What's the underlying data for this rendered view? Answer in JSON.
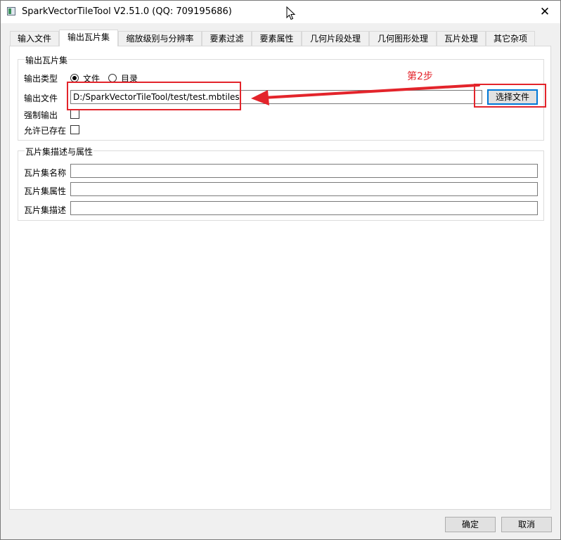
{
  "window": {
    "title": "SparkVectorTileTool V2.51.0  (QQ: 709195686)",
    "close_glyph": "✕"
  },
  "tabs": [
    {
      "label": "输入文件",
      "active": false
    },
    {
      "label": "输出瓦片集",
      "active": true
    },
    {
      "label": "缩放级别与分辨率",
      "active": false
    },
    {
      "label": "要素过滤",
      "active": false
    },
    {
      "label": "要素属性",
      "active": false
    },
    {
      "label": "几何片段处理",
      "active": false
    },
    {
      "label": "几何图形处理",
      "active": false
    },
    {
      "label": "瓦片处理",
      "active": false
    },
    {
      "label": "其它杂项",
      "active": false
    }
  ],
  "output_group": {
    "title": "输出瓦片集",
    "output_type_label": "输出类型",
    "radio_file_label": "文件",
    "radio_dir_label": "目录",
    "selected_type": "文件",
    "output_file_label": "输出文件",
    "output_file_value": "D:/SparkVectorTileTool/test/test.mbtiles",
    "choose_file_button": "选择文件",
    "force_output_label": "强制输出",
    "force_output_checked": false,
    "allow_existing_label": "允许已存在",
    "allow_existing_checked": false
  },
  "annotation": {
    "step_text": "第2步",
    "color": "#e3242b"
  },
  "desc_group": {
    "title": "瓦片集描述与属性",
    "name_label": "瓦片集名称",
    "name_value": "",
    "attr_label": "瓦片集属性",
    "attr_value": "",
    "desc_label": "瓦片集描述",
    "desc_value": ""
  },
  "footer": {
    "ok_button": "确定",
    "cancel_button": "取消"
  },
  "icons": {
    "app": "app-window-icon",
    "close": "close-icon",
    "cursor": "mouse-cursor-icon"
  }
}
